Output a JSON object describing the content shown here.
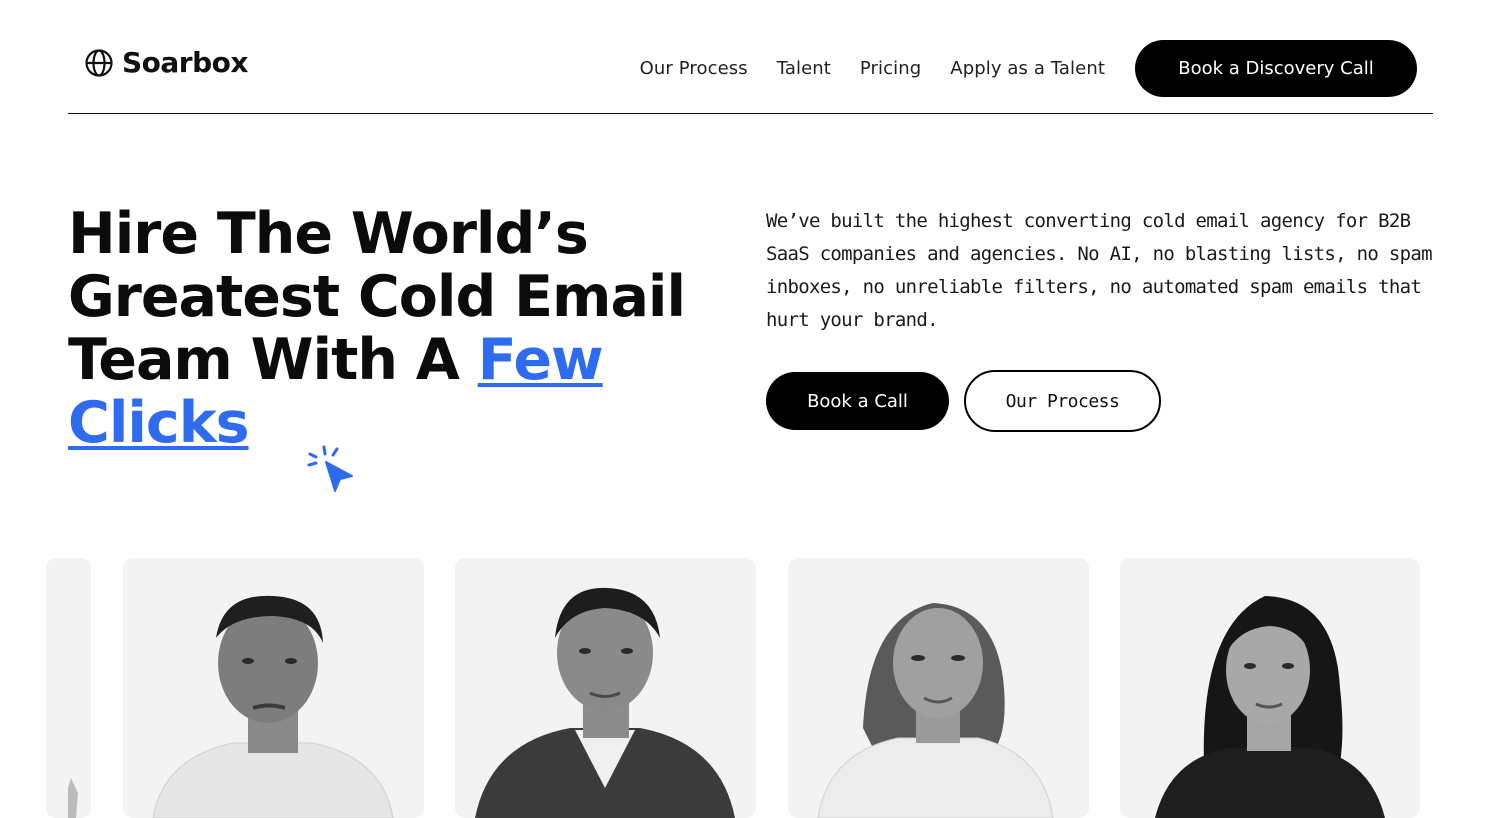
{
  "header": {
    "logo_text": "Soarbox",
    "nav": [
      "Our Process",
      "Talent",
      "Pricing",
      "Apply as a Talent"
    ],
    "cta_label": "Book a Discovery Call"
  },
  "hero": {
    "title_main": "Hire The World’s Greatest Cold Email Team With A ",
    "title_accent": "Few Clicks",
    "description": "We’ve built the highest converting cold email agency for B2B SaaS companies and agencies. No AI, no blasting lists, no spam inboxes, no unreliable filters, no automated spam emails that hurt your brand.",
    "primary_button": "Book a Call",
    "secondary_button": "Our Process"
  },
  "talent_cards": [
    {
      "photo": "partial-card"
    },
    {
      "photo": "man-white-tshirt"
    },
    {
      "photo": "man-suit"
    },
    {
      "photo": "woman-white-blazer"
    },
    {
      "photo": "woman-black-top"
    }
  ],
  "colors": {
    "accent": "#2f6bef",
    "button_dark": "#000000",
    "card_bg": "#f3f3f3"
  },
  "icons": [
    "globe-icon",
    "cursor-click-icon"
  ]
}
